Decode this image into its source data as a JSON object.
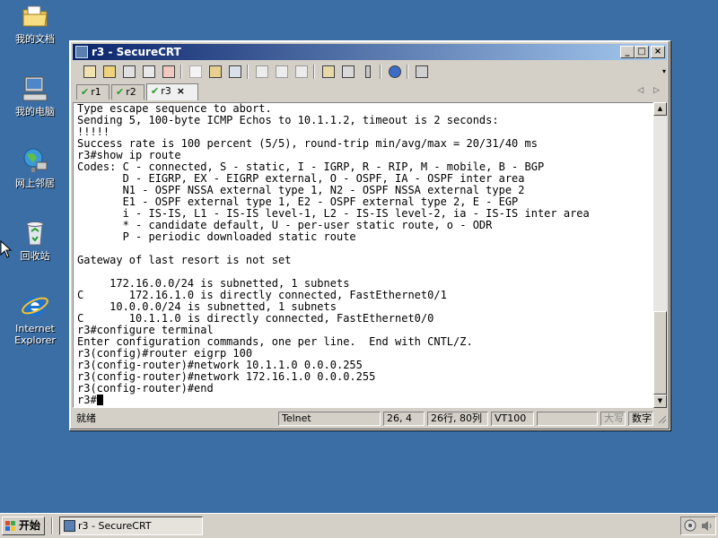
{
  "desktop": {
    "icons": [
      {
        "label": "我的文档",
        "icon": "folder-documents-icon"
      },
      {
        "label": "我的电脑",
        "icon": "my-computer-icon"
      },
      {
        "label": "网上邻居",
        "icon": "network-places-icon"
      },
      {
        "label": "回收站",
        "icon": "recycle-bin-icon"
      },
      {
        "label": "Internet Explorer",
        "icon": "internet-explorer-icon"
      }
    ]
  },
  "window": {
    "title": "r3 - SecureCRT",
    "controls": {
      "minimize": "_",
      "maximize": "□",
      "close": "×"
    }
  },
  "toolbar": {
    "icons": [
      "connect-icon",
      "quick-connect-icon",
      "connect-tab-icon",
      "reconnect-icon",
      "disconnect-icon",
      "copy-icon",
      "paste-icon",
      "find-icon",
      "print-icon",
      "print-selection-icon",
      "print-setup-icon",
      "session-options-icon",
      "global-options-icon",
      "keymap-icon",
      "help-icon",
      "sftp-icon"
    ]
  },
  "tabs": [
    {
      "label": "r1",
      "active": false
    },
    {
      "label": "r2",
      "active": false
    },
    {
      "label": "r3",
      "active": true,
      "close": "×"
    }
  ],
  "tab_nav": {
    "prev": "◁",
    "next": "▷"
  },
  "terminal": {
    "lines": [
      "Type escape sequence to abort.",
      "Sending 5, 100-byte ICMP Echos to 10.1.1.2, timeout is 2 seconds:",
      "!!!!!",
      "Success rate is 100 percent (5/5), round-trip min/avg/max = 20/31/40 ms",
      "r3#show ip route",
      "Codes: C - connected, S - static, I - IGRP, R - RIP, M - mobile, B - BGP",
      "       D - EIGRP, EX - EIGRP external, O - OSPF, IA - OSPF inter area",
      "       N1 - OSPF NSSA external type 1, N2 - OSPF NSSA external type 2",
      "       E1 - OSPF external type 1, E2 - OSPF external type 2, E - EGP",
      "       i - IS-IS, L1 - IS-IS level-1, L2 - IS-IS level-2, ia - IS-IS inter area",
      "       * - candidate default, U - per-user static route, o - ODR",
      "       P - periodic downloaded static route",
      "",
      "Gateway of last resort is not set",
      "",
      "     172.16.0.0/24 is subnetted, 1 subnets",
      "C       172.16.1.0 is directly connected, FastEthernet0/1",
      "     10.0.0.0/24 is subnetted, 1 subnets",
      "C       10.1.1.0 is directly connected, FastEthernet0/0",
      "r3#configure terminal",
      "Enter configuration commands, one per line.  End with CNTL/Z.",
      "r3(config)#router eigrp 100",
      "r3(config-router)#network 10.1.1.0 0.0.0.255",
      "r3(config-router)#network 172.16.1.0 0.0.0.255",
      "r3(config-router)#end"
    ],
    "prompt": "r3#"
  },
  "statusbar": {
    "ready": "就绪",
    "protocol": "Telnet",
    "cursor_pos": "26,  4",
    "size": "26行, 80列",
    "emulation": "VT100",
    "empty": "",
    "caps": "大写",
    "num": "数字"
  },
  "taskbar": {
    "start_label": "开始",
    "task_label": "r3 - SecureCRT"
  },
  "colors": {
    "desktop": "#3a6ea5",
    "title_active": "#0a246a",
    "tab_check": "#2a9a2a"
  }
}
